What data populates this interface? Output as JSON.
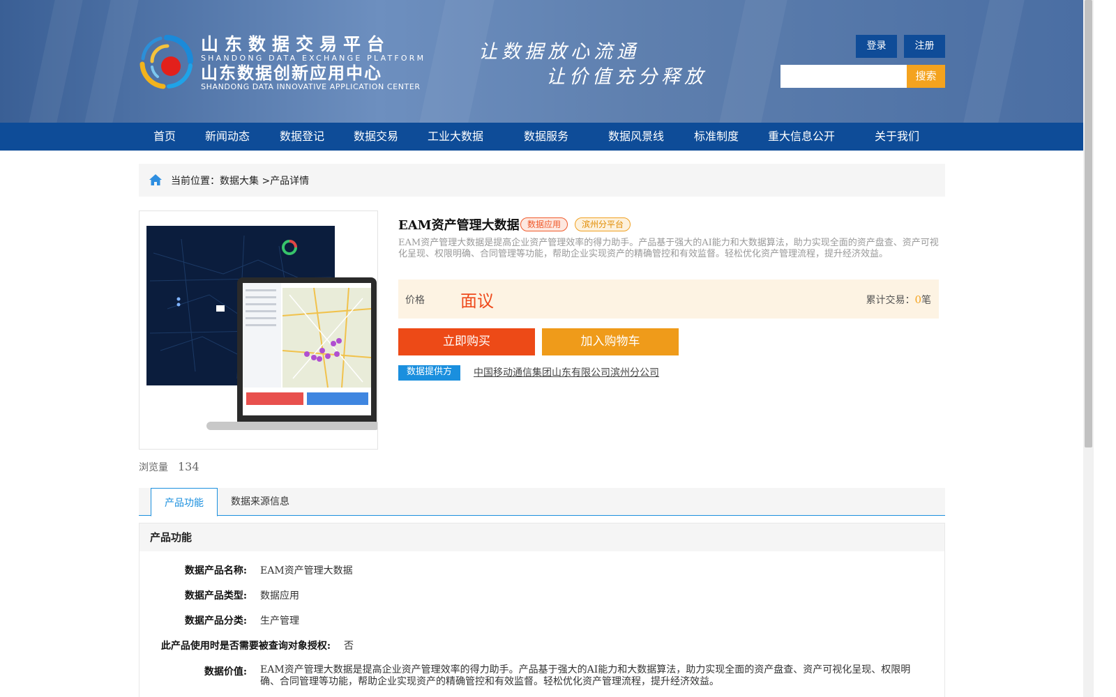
{
  "brand": {
    "cn_line1": "山东数据交易平台",
    "en_line1": "SHANDONG DATA EXCHANGE PLATFORM",
    "cn_line2": "山东数据创新应用中心",
    "en_line2": "SHANDONG DATA INNOVATIVE APPLICATION CENTER"
  },
  "slogan": {
    "line1": "让数据放心流通",
    "line2": "让价值充分释放"
  },
  "header": {
    "login_label": "登录",
    "register_label": "注册",
    "search_placeholder": "",
    "search_label": "搜索"
  },
  "nav": {
    "items": [
      "首页",
      "新闻动态",
      "数据登记",
      "数据交易",
      "工业大数据",
      "数据服务",
      "数据风景线",
      "标准制度",
      "重大信息公开",
      "关于我们"
    ]
  },
  "breadcrumb": {
    "prefix": "当前位置：",
    "parent": "数据大集",
    "sep": " >",
    "current": "产品详情"
  },
  "product": {
    "title": "EAM资产管理大数据",
    "tags": [
      "数据应用",
      "滨州分平台"
    ],
    "description": "EAM资产管理大数据是提高企业资产管理效率的得力助手。产品基于强大的AI能力和大数据算法，助力实现全面的资产盘查、资产可视化呈现、权限明确、合同管理等功能，帮助企业实现资产的精确管控和有效监督。轻松优化资产管理流程，提升经济效益。",
    "price_label": "价格",
    "price_value": "面议",
    "trade_count_label": "累计交易：",
    "trade_count": "0",
    "trade_count_unit": "笔",
    "buy_label": "立即购买",
    "cart_label": "加入购物车",
    "provider_badge": "数据提供方",
    "provider_name": "中国移动通信集团山东有限公司滨州分公司",
    "views_label": "浏览量",
    "views": "134"
  },
  "tabs": [
    {
      "label": "产品功能",
      "active": true
    },
    {
      "label": "数据来源信息",
      "active": false
    }
  ],
  "section": {
    "title": "产品功能",
    "fields": [
      {
        "key": "数据产品名称:",
        "value": "EAM资产管理大数据"
      },
      {
        "key": "数据产品类型:",
        "value": "数据应用"
      },
      {
        "key": "数据产品分类:",
        "value": "生产管理"
      },
      {
        "key": "此产品使用时是否需要被查询对象授权:",
        "value": "否"
      },
      {
        "key": "数据价值:",
        "value": "EAM资产管理大数据是提高企业资产管理效率的得力助手。产品基于强大的AI能力和大数据算法，助力实现全面的资产盘查、资产可视化呈现、权限明确、合同管理等功能，帮助企业实现资产的精确管控和有效监督。轻松优化资产管理流程，提升经济效益。"
      }
    ]
  },
  "colors": {
    "nav_bg": "#0e4c98",
    "accent_blue": "#1a8fde",
    "buy_red": "#ed4a17",
    "cart_orange": "#ef9b1a",
    "search_orange": "#f4a31f"
  }
}
